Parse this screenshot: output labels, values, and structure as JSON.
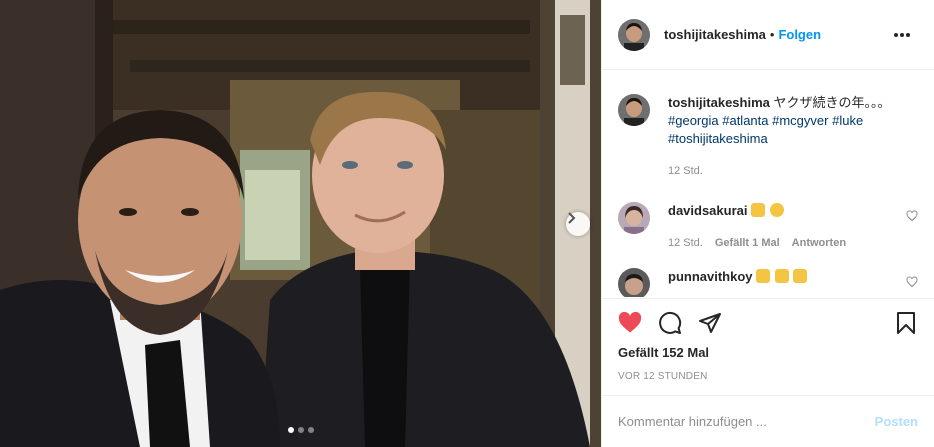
{
  "post": {
    "username": "toshijitakeshima",
    "separator": "•",
    "follow_label": "Folgen",
    "caption_text": "ヤクザ続きの年。。。",
    "hashtags": [
      "#georgia",
      "#atlanta",
      "#mcgyver",
      "#luke",
      "#toshijitakeshima"
    ],
    "caption_time": "12 Std.",
    "comments": [
      {
        "username": "davidsakurai",
        "emoji": [
          "vulcan-salute-emoji",
          "smiling-face-emoji"
        ],
        "time": "12 Std.",
        "likes": "Gefällt 1 Mal",
        "reply_label": "Antworten"
      },
      {
        "username": "punnavithkoy",
        "emoji": [
          "thumbs-up-emoji",
          "thumbs-up-emoji",
          "thumbs-up-emoji"
        ]
      }
    ],
    "likes_text": "Gefällt 152 Mal",
    "posted_ago": "VOR 12 STUNDEN",
    "comment_placeholder": "Kommentar hinzufügen ...",
    "post_button_label": "Posten",
    "carousel": {
      "slide_count": 3,
      "active_index": 0
    },
    "colors": {
      "like_red": "#ed4956",
      "link_blue": "#0095f6",
      "hashtag": "#00376b",
      "muted": "#8e8e8e",
      "post_disabled": "#b2dffc"
    }
  }
}
